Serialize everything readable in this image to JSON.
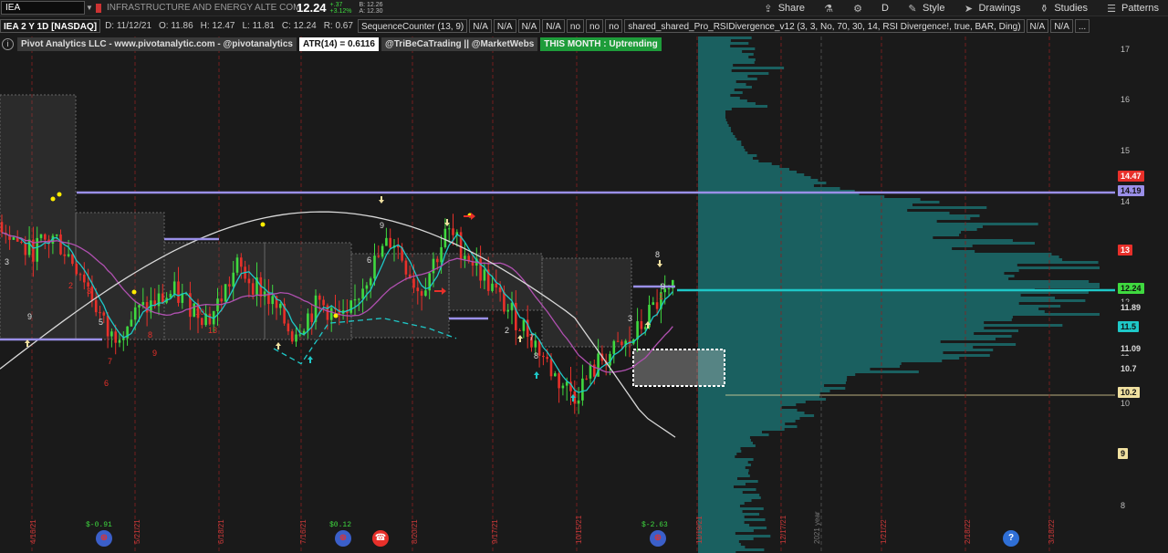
{
  "toolbar": {
    "symbol": "IEA",
    "description": "INFRASTRUCTURE AND ENERGY ALTE COM",
    "price": "12.24",
    "change": "+.37",
    "change_pct": "+3.12%",
    "bid": "B: 12.26",
    "ask": "A: 12.30",
    "buttons": [
      {
        "label": "Share",
        "icon": "share-icon"
      },
      {
        "label": "",
        "icon": "flask-icon"
      },
      {
        "label": "",
        "icon": "gear-icon"
      },
      {
        "label": "D",
        "icon": "drawing-set-icon"
      },
      {
        "label": "Style",
        "icon": "style-icon"
      },
      {
        "label": "Drawings",
        "icon": "cursor-icon"
      },
      {
        "label": "Studies",
        "icon": "studies-icon"
      },
      {
        "label": "Patterns",
        "icon": "patterns-icon"
      }
    ]
  },
  "studybar": {
    "title": "IEA 2 Y 1D [NASDAQ]",
    "date": "D: 11/12/21",
    "open": "O: 11.86",
    "high": "H: 12.47",
    "low": "L: 11.81",
    "close": "C: 12.24",
    "range": "R: 0.67",
    "seq": "SequenceCounter (13, 9)",
    "na1": "N/A",
    "na2": "N/A",
    "na3": "N/A",
    "na4": "N/A",
    "no1": "no",
    "no2": "no",
    "no3": "no",
    "rsi": "shared_shared_Pro_RSIDivergence_v12 (3, 3, No, 70, 30, 14, RSI Divergence!, true, BAR, Ding)",
    "na5": "N/A",
    "na6": "N/A",
    "more": "..."
  },
  "infobar": {
    "info": "i",
    "brand": "Pivot Analytics LLC - www.pivotanalytic.com - @pivotanalytics",
    "atr": "ATR(14) = 0.6116",
    "handles": "@TriBeCaTrading || @MarketWebs",
    "month": "THIS MONTH : Uptrending"
  },
  "axis": {
    "ticks": [
      "17",
      "16",
      "15",
      "14",
      "13",
      "12",
      "11",
      "10",
      "9",
      "8"
    ],
    "tags": [
      {
        "text": "14.47",
        "bg": "#e8302a",
        "fg": "#ffffff"
      },
      {
        "text": "14.19",
        "bg": "#9a8fe8",
        "fg": "#111111"
      },
      {
        "text": "13",
        "bg": "#e8302a",
        "fg": "#ffffff"
      },
      {
        "text": "12.24",
        "bg": "#3fd93f",
        "fg": "#111111"
      },
      {
        "text": "11.89",
        "bg": "#1a1a1a",
        "fg": "#dddddd"
      },
      {
        "text": "11.5",
        "bg": "#1ec8c8",
        "fg": "#111111"
      },
      {
        "text": "11.09",
        "bg": "#1a1a1a",
        "fg": "#dddddd"
      },
      {
        "text": "10.7",
        "bg": "#1a1a1a",
        "fg": "#dddddd"
      },
      {
        "text": "10.2",
        "bg": "#f0e0a0",
        "fg": "#111111"
      },
      {
        "text": "9",
        "bg": "#f0e0a0",
        "fg": "#111111"
      }
    ]
  },
  "dates": [
    "4/16/21",
    "5/21/21",
    "6/18/21",
    "7/16/21",
    "8/20/21",
    "9/17/21",
    "10/15/21",
    "11/19/21",
    "12/17/21",
    "2021 year",
    "1/21/22",
    "2/18/22",
    "3/18/22"
  ],
  "events": {
    "div1": "$-0.91",
    "div2": "$0.12",
    "div3": "$-2.63",
    "help": "?"
  },
  "colors": {
    "background": "#1a1a1a",
    "up": "#3fd93f",
    "down": "#e8302a",
    "ma_white": "#d8d8d8",
    "ma_cyan": "#1ec8c8",
    "ma_magenta": "#b050b0",
    "pivot_line": "#9a8fe8",
    "volume_profile": "#1a6060"
  }
}
